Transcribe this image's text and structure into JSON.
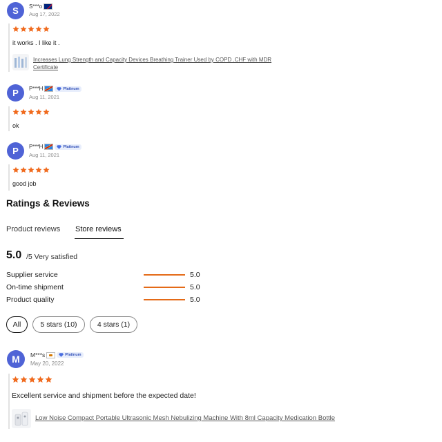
{
  "reviews_top": [
    {
      "initial": "S",
      "name": "S***o",
      "country_flag": "australia-flag",
      "date": "Aug 17, 2022",
      "rating": 5,
      "text": "it works . I like it .",
      "product_line1": "Increases Lung Strength and Capacity Devices Breathing Trainer Used by COPD .CHF with MDR",
      "product_line2": "Certificate"
    },
    {
      "initial": "P",
      "name": "P***H",
      "country_flag": "congo-dr-flag",
      "badge": "Platinum",
      "date": "Aug 11, 2021",
      "rating": 5,
      "text": "ok"
    },
    {
      "initial": "P",
      "name": "P***H",
      "country_flag": "congo-dr-flag",
      "badge": "Platinum",
      "date": "Aug 11, 2021",
      "rating": 5,
      "text": "good job"
    }
  ],
  "section": {
    "title": "Ratings & Reviews",
    "tabs": [
      {
        "label": "Product reviews",
        "active": false
      },
      {
        "label": "Store reviews",
        "active": true
      }
    ],
    "score": "5.0",
    "score_suffix": "/5 Very satisfied",
    "metrics": [
      {
        "label": "Supplier service",
        "value": "5.0",
        "fill": 1.0
      },
      {
        "label": "On-time shipment",
        "value": "5.0",
        "fill": 1.0
      },
      {
        "label": "Product quality",
        "value": "5.0",
        "fill": 1.0
      }
    ],
    "filters": [
      {
        "label": "All",
        "active": true
      },
      {
        "label": "5 stars (10)",
        "active": false
      },
      {
        "label": "4 stars (1)",
        "active": false
      }
    ]
  },
  "store_review": {
    "initial": "M",
    "name": "M***s",
    "country_flag": "cyprus-flag",
    "badge": "Platinum",
    "date": "May 20, 2022",
    "rating": 5,
    "text": "Excellent service and shipment before the expected date!",
    "product": "Low Noise Compact Portable Ultrasonic Mesh Nebulizing Machine With 8ml Capacity Medication Bottle"
  },
  "colors": {
    "star": "#f06a1d",
    "avatar": "#4f63d6",
    "metric_bar": "#e46a17"
  }
}
